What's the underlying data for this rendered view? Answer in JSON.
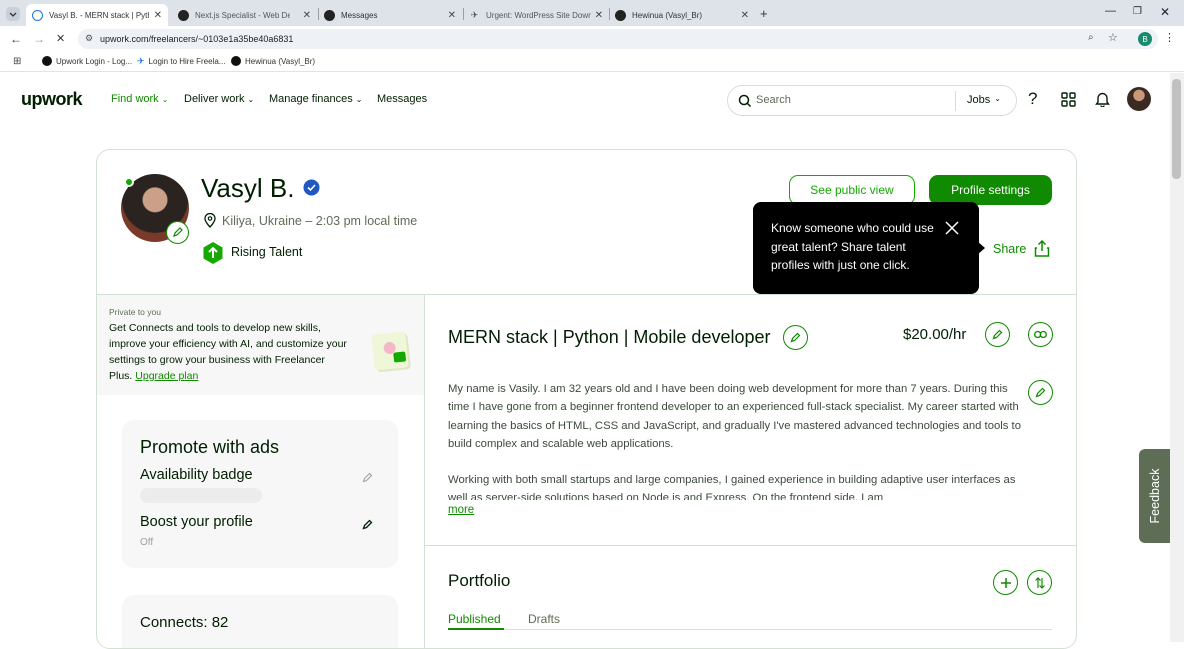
{
  "browser": {
    "tabs": [
      {
        "label": "Vasyl B. - MERN stack | Python",
        "active": true
      },
      {
        "label": "Next.js Specialist - Web Develo"
      },
      {
        "label": "Messages"
      },
      {
        "label": "Urgent: WordPress Site Downtim"
      },
      {
        "label": "Hewinua (Vasyl_Br)"
      }
    ],
    "url": "upwork.com/freelancers/~0103e1a35be40a6831",
    "profile_initial": "B",
    "bookmarks": [
      "Upwork Login - Log...",
      "Login to Hire Freela...",
      "Hewinua (Vasyl_Br)"
    ]
  },
  "header": {
    "logo": "upwork",
    "nav": [
      "Find work",
      "Deliver work",
      "Manage finances",
      "Messages"
    ],
    "search_placeholder": "Search",
    "search_scope": "Jobs"
  },
  "profile": {
    "name": "Vasyl B.",
    "location": "Kiliya, Ukraine – 2:03 pm local time",
    "badge": "Rising Talent",
    "see_public_view": "See public view",
    "profile_settings": "Profile settings",
    "share": "Share"
  },
  "tooltip": {
    "text": "Know someone who could use great talent? Share talent profiles with just one click."
  },
  "sidebar": {
    "private_label": "Private to you",
    "promo_text": "Get Connects and tools to develop new skills, improve your efficiency with AI, and customize your settings to grow your business with Freelancer Plus.",
    "upgrade_link": "Upgrade plan",
    "promote_title": "Promote with ads",
    "availability_badge": "Availability badge",
    "boost_profile": "Boost your profile",
    "boost_status": "Off",
    "connects": "Connects: 82"
  },
  "main": {
    "title": "MERN stack | Python | Mobile developer",
    "rate": "$20.00/hr",
    "para1": "My name is Vasily. I am 32 years old and I have been doing web development for more than 7 years. During this time I have gone from a beginner frontend developer to an experienced full-stack specialist. My career started with learning the basics of HTML, CSS and JavaScript, and gradually I've mastered advanced technologies and tools to build complex and scalable web applications.",
    "para2": "Working with both small startups and large companies, I gained experience in building adaptive user interfaces as well as server-side solutions based on Node.js and Express. On the frontend side, I am",
    "more": "more",
    "portfolio_title": "Portfolio",
    "portfolio_tabs": [
      "Published",
      "Drafts"
    ]
  },
  "feedback": "Feedback",
  "colors": {
    "brand": "#108a00",
    "accent": "#14a800",
    "text": "#001e00"
  }
}
